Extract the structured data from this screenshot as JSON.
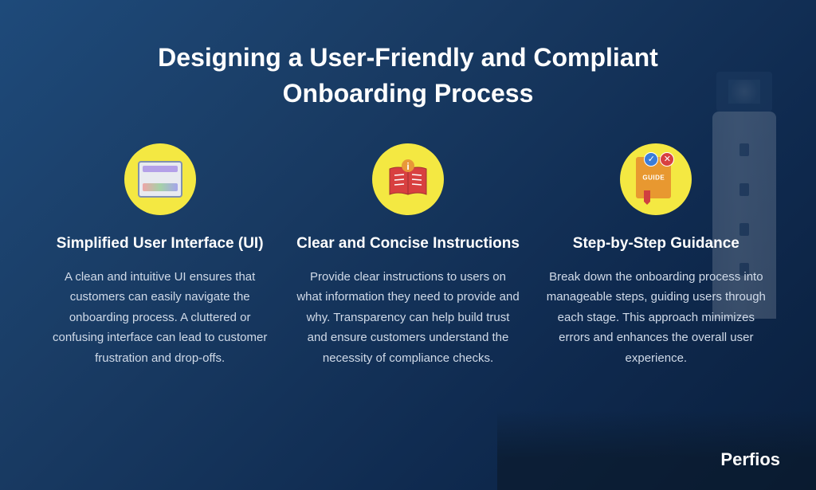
{
  "title": "Designing a User-Friendly and Compliant Onboarding Process",
  "features": [
    {
      "title": "Simplified User Interface (UI)",
      "description": "A clean and intuitive UI ensures that customers can easily navigate the onboarding process. A cluttered or confusing interface can lead to customer frustration and drop-offs."
    },
    {
      "title": "Clear and Concise Instructions",
      "description": "Provide clear instructions to users on what information they need to provide and why. Transparency can help build trust and ensure customers understand the necessity of compliance checks."
    },
    {
      "title": "Step-by-Step Guidance",
      "description": "Break down the onboarding process into manageable steps, guiding users through each stage. This approach minimizes errors and enhances the overall user experience."
    }
  ],
  "brand": "Perfios"
}
